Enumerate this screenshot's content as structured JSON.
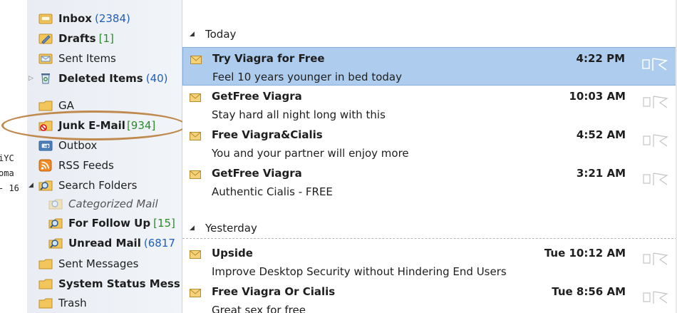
{
  "left_fragments": [
    "iYC",
    "oma",
    "- 16"
  ],
  "folders": [
    {
      "name": "Inbox",
      "count": "(2384)",
      "count_color": "blue",
      "bold": true,
      "icon": "inbox-icon"
    },
    {
      "name": "Drafts",
      "count": "[1]",
      "count_color": "green",
      "bold": true,
      "icon": "drafts-icon"
    },
    {
      "name": "Sent Items",
      "count": "",
      "bold": false,
      "icon": "sent-items-icon"
    },
    {
      "name": "Deleted Items",
      "count": "(40)",
      "count_color": "blue",
      "bold": true,
      "icon": "deleted-items-icon"
    },
    {
      "name": "GA",
      "count": "",
      "bold": false,
      "icon": "folder-icon"
    },
    {
      "name": "Junk E-Mail",
      "count": "[934]",
      "count_color": "green",
      "bold": true,
      "icon": "junk-mail-icon"
    },
    {
      "name": "Outbox",
      "count": "",
      "bold": false,
      "icon": "outbox-icon"
    },
    {
      "name": "RSS Feeds",
      "count": "",
      "bold": false,
      "icon": "rss-icon"
    },
    {
      "name": "Search Folders",
      "count": "",
      "bold": false,
      "icon": "search-folder-icon"
    },
    {
      "name": "Categorized Mail",
      "count": "",
      "bold": false,
      "italic": true,
      "icon": "search-folder-icon"
    },
    {
      "name": "For Follow Up",
      "count": "[15]",
      "count_color": "green",
      "bold": true,
      "icon": "search-folder-icon"
    },
    {
      "name": "Unread Mail",
      "count": "(6817",
      "count_color": "blue",
      "bold": true,
      "icon": "search-folder-icon"
    },
    {
      "name": "Sent Messages",
      "count": "",
      "bold": false,
      "icon": "folder-icon"
    },
    {
      "name": "System Status Mess",
      "count": "",
      "bold": true,
      "icon": "folder-icon"
    },
    {
      "name": "Trash",
      "count": "",
      "bold": false,
      "icon": "folder-icon"
    }
  ],
  "groups": [
    {
      "label": "Today"
    },
    {
      "label": "Yesterday"
    }
  ],
  "messages": [
    {
      "sender": "Try Viagra for Free",
      "subject": "Feel 10 years younger in bed today",
      "time": "4:22 PM",
      "selected": true
    },
    {
      "sender": "GetFree Viagra",
      "subject": "Stay hard all night long with this",
      "time": "10:03 AM",
      "selected": false
    },
    {
      "sender": "Free Viagra&Cialis",
      "subject": "You and your partner will enjoy more",
      "time": "4:52 AM",
      "selected": false
    },
    {
      "sender": "GetFree Viagra",
      "subject": "Authentic Cialis - FREE",
      "time": "3:21 AM",
      "selected": false
    },
    {
      "sender": "Upside",
      "subject": "Improve Desktop Security without Hindering End Users",
      "time": "Tue 10:12 AM",
      "selected": false
    },
    {
      "sender": "Free Viagra Or Cialis",
      "subject": "Great sex for free",
      "time": "Tue 8:56 AM",
      "selected": false
    }
  ],
  "colors": {
    "selection": "#aecdee",
    "count_blue": "#1f5dc0",
    "count_green": "#2a8a2a",
    "annotation_ring": "#c08a4e"
  }
}
